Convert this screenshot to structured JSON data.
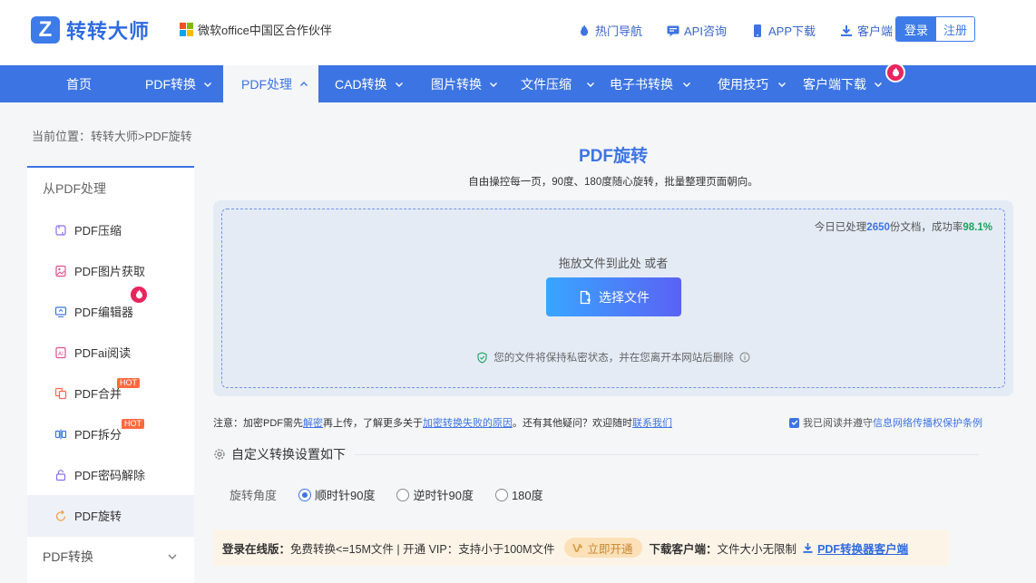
{
  "brand": {
    "logo_letter": "Z",
    "name": "转转大师",
    "partner": "微软office中国区合作伙伴"
  },
  "top_links": [
    {
      "label": "热门导航",
      "icon": "flame-icon"
    },
    {
      "label": "API咨询",
      "icon": "chat-icon"
    },
    {
      "label": "APP下载",
      "icon": "phone-icon"
    },
    {
      "label": "客户端",
      "icon": "download-icon"
    }
  ],
  "auth": {
    "login": "登录",
    "register": "注册"
  },
  "nav": [
    {
      "label": "首页"
    },
    {
      "label": "PDF转换"
    },
    {
      "label": "PDF处理"
    },
    {
      "label": "CAD转换"
    },
    {
      "label": "图片转换"
    },
    {
      "label": "文件压缩"
    },
    {
      "label": "电子书转换"
    },
    {
      "label": "使用技巧"
    },
    {
      "label": "客户端下载"
    }
  ],
  "breadcrumb": "当前位置：转转大师>PDF旋转",
  "sidebar": {
    "header": "从PDF处理",
    "items": [
      {
        "label": "PDF压缩",
        "icon": "compress-icon"
      },
      {
        "label": "PDF图片获取",
        "icon": "image-extract-icon"
      },
      {
        "label": "PDF编辑器",
        "icon": "editor-icon"
      },
      {
        "label": "PDFai阅读",
        "icon": "ai-read-icon"
      },
      {
        "label": "PDF合并",
        "icon": "merge-icon",
        "tag": "HOT"
      },
      {
        "label": "PDF拆分",
        "icon": "split-icon",
        "tag": "HOT"
      },
      {
        "label": "PDF密码解除",
        "icon": "unlock-icon"
      },
      {
        "label": "PDF旋转",
        "icon": "rotate-icon"
      }
    ],
    "group": "PDF转换"
  },
  "main": {
    "title": "PDF旋转",
    "subtitle": "自由操控每一页，90度、180度随心旋转，批量整理页面朝向。",
    "stats": {
      "prefix": "今日已处理",
      "count": "2650",
      "middle": "份文档，成功率",
      "rate": "98.1%"
    },
    "drop_text": "拖放文件到此处 或者",
    "choose_button": "选择文件",
    "privacy": "您的文件将保持私密状态，并在您离开本网站后删除"
  },
  "notice": {
    "p1": "注意：加密PDF需先",
    "link1": "解密",
    "p2": "再上传，了解更多关于",
    "link2": "加密转换失败的原因",
    "p3": "。还有其他疑问？欢迎随时",
    "link3": "联系我们"
  },
  "agree": {
    "checked": true,
    "p1": "我已阅读并遵守",
    "link": "信息网络传播权保护条例"
  },
  "settings": {
    "title": "自定义转换设置如下",
    "rotate_label": "旋转角度",
    "options": [
      {
        "label": "顺时针90度",
        "selected": true
      },
      {
        "label": "逆时针90度",
        "selected": false
      },
      {
        "label": "180度",
        "selected": false
      }
    ]
  },
  "promo": {
    "online_label": "登录在线版：",
    "online_text": "免费转换<=15M文件 | 开通 VIP：支持小于100M文件",
    "vip_button": "立即开通",
    "client_label": "下载客户端：",
    "client_text": "文件大小无限制",
    "client_link": "PDF转换器客户端"
  },
  "colors": {
    "primary": "#3d74e3",
    "hot": "#e8265e",
    "success": "#1aa35a"
  }
}
